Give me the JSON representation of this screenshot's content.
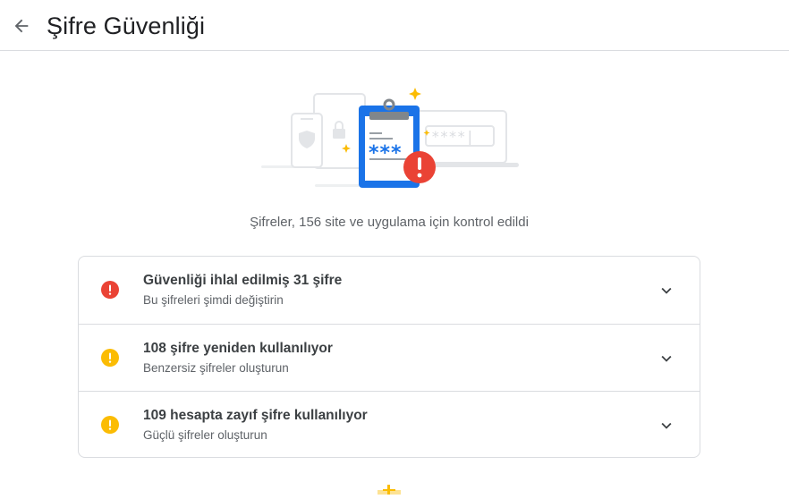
{
  "header": {
    "title": "Şifre Güvenliği",
    "back_icon": "arrow-back-icon"
  },
  "hero": {
    "icons": [
      "phone-icon",
      "shield-icon",
      "lock-icon",
      "clipboard-icon",
      "password-field-icon",
      "sparkle-icon",
      "alert-icon"
    ],
    "clipboard_mask": "***",
    "field_mask": "****|"
  },
  "summary": "Şifreler, 156 site ve uygulama için kontrol edildi",
  "issues": [
    {
      "title": "Güvenliği ihlal edilmiş 31 şifre",
      "subtitle": "Bu şifreleri şimdi değiştirin",
      "icon": "error-icon",
      "color": "#ea4335"
    },
    {
      "title": "108 şifre yeniden kullanılıyor",
      "subtitle": "Benzersiz şifreler oluşturun",
      "icon": "warning-icon",
      "color": "#fbbc04"
    },
    {
      "title": "109 hesapta zayıf şifre kullanılıyor",
      "subtitle": "Güçlü şifreler oluşturun",
      "icon": "warning-icon",
      "color": "#fbbc04"
    }
  ],
  "colors": {
    "blue": "#1a73e8",
    "red": "#ea4335",
    "yellow": "#fbbc04",
    "divider": "#dadce0"
  }
}
